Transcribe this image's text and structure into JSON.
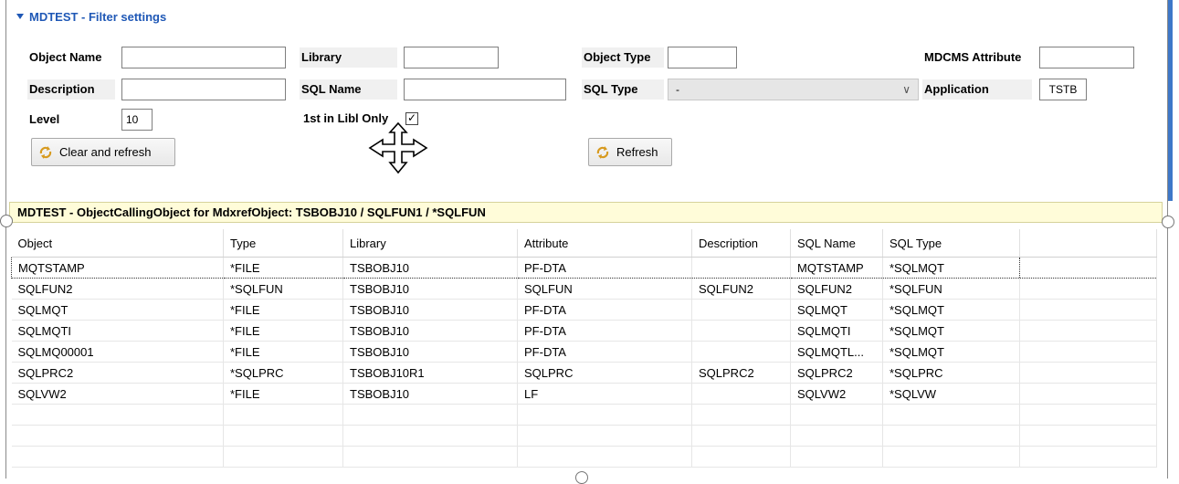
{
  "filter": {
    "title": "MDTEST - Filter settings",
    "object_name_label": "Object Name",
    "object_name_value": "",
    "library_label": "Library",
    "library_value": "",
    "object_type_label": "Object Type",
    "object_type_value": "",
    "mdcms_attribute_label": "MDCMS Attribute",
    "mdcms_attribute_value": "",
    "description_label": "Description",
    "description_value": "",
    "sql_name_label": "SQL Name",
    "sql_name_value": "",
    "sql_type_label": "SQL Type",
    "sql_type_value": "-",
    "application_label": "Application",
    "application_value": "TSTB",
    "level_label": "Level",
    "level_value": "10",
    "first_in_libl_label": "1st in Libl Only",
    "first_in_libl_checked": "✓",
    "clear_refresh_label": "Clear and refresh",
    "refresh_label": "Refresh"
  },
  "results": {
    "title": "MDTEST - ObjectCallingObject for MdxrefObject: TSBOBJ10 / SQLFUN1 / *SQLFUN",
    "columns": [
      "Object",
      "Type",
      "Library",
      "Attribute",
      "Description",
      "SQL Name",
      "SQL Type"
    ],
    "rows": [
      [
        "MQTSTAMP",
        "*FILE",
        "TSBOBJ10",
        "PF-DTA",
        "",
        "MQTSTAMP",
        "*SQLMQT"
      ],
      [
        "SQLFUN2",
        "*SQLFUN",
        "TSBOBJ10",
        "SQLFUN",
        "SQLFUN2",
        "SQLFUN2",
        "*SQLFUN"
      ],
      [
        "SQLMQT",
        "*FILE",
        "TSBOBJ10",
        "PF-DTA",
        "",
        "SQLMQT",
        "*SQLMQT"
      ],
      [
        "SQLMQTI",
        "*FILE",
        "TSBOBJ10",
        "PF-DTA",
        "",
        "SQLMQTI",
        "*SQLMQT"
      ],
      [
        "SQLMQ00001",
        "*FILE",
        "TSBOBJ10",
        "PF-DTA",
        "",
        "SQLMQTL...",
        "*SQLMQT"
      ],
      [
        "SQLPRC2",
        "*SQLPRC",
        "TSBOBJ10R1",
        "SQLPRC",
        "SQLPRC2",
        "SQLPRC2",
        "*SQLPRC"
      ],
      [
        "SQLVW2",
        "*FILE",
        "TSBOBJ10",
        "LF",
        "",
        "SQLVW2",
        "*SQLVW"
      ]
    ]
  },
  "icons": {
    "refresh": "refresh-icon",
    "cursor": "move-cursor-icon"
  }
}
